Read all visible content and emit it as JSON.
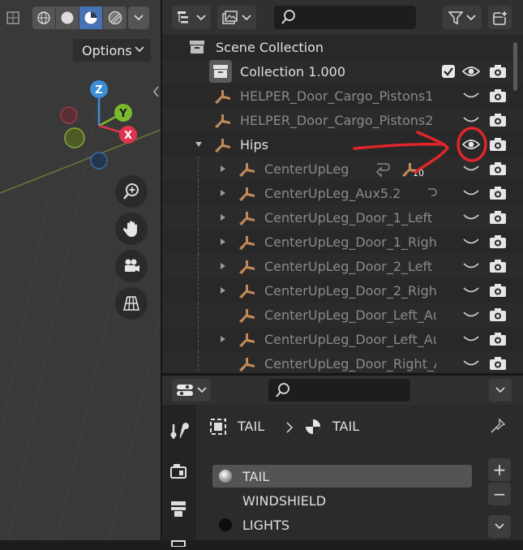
{
  "viewport": {
    "options_label": "Options",
    "gizmo_axes": {
      "z": "Z",
      "y": "Y",
      "x": "X"
    }
  },
  "outliner": {
    "rows": [
      {
        "label": "Scene Collection",
        "kind": "scene",
        "dim": false
      },
      {
        "label": "Collection 1.000",
        "kind": "collection",
        "dim": false
      },
      {
        "label": "HELPER_Door_Cargo_Pistons1",
        "kind": "armature",
        "dim": true
      },
      {
        "label": "HELPER_Door_Cargo_Pistons2",
        "kind": "armature",
        "dim": true
      },
      {
        "label": "Hips",
        "kind": "armature",
        "dim": false
      },
      {
        "label": "CenterUpLeg",
        "kind": "armature",
        "dim": true
      },
      {
        "label": "CenterUpLeg_Aux5.2",
        "kind": "armature",
        "dim": true
      },
      {
        "label": "CenterUpLeg_Door_1_Left",
        "kind": "armature",
        "dim": true
      },
      {
        "label": "CenterUpLeg_Door_1_Righ",
        "kind": "armature",
        "dim": true
      },
      {
        "label": "CenterUpLeg_Door_2_Left",
        "kind": "armature",
        "dim": true
      },
      {
        "label": "CenterUpLeg_Door_2_Righ",
        "kind": "armature",
        "dim": true
      },
      {
        "label": "CenterUpLeg_Door_Left_Au",
        "kind": "armature",
        "dim": true
      },
      {
        "label": "CenterUpLeg_Door_Left_Au",
        "kind": "armature",
        "dim": true
      },
      {
        "label": "CenterUpLeg_Door_Right_A",
        "kind": "armature",
        "dim": true
      }
    ],
    "child_count": "10"
  },
  "properties": {
    "breadcrumb_object": "TAIL",
    "breadcrumb_material": "TAIL",
    "materials": [
      "TAIL",
      "WINDSHIELD",
      "LIGHTS"
    ],
    "add_label": "+",
    "remove_label": "−"
  },
  "colors": {
    "accent": "#4772b3",
    "bone": "#c08a5a",
    "annotation": "#e0262a"
  }
}
